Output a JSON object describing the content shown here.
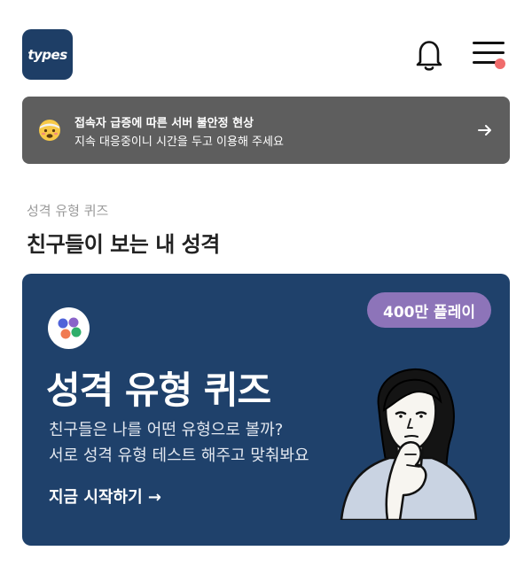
{
  "header": {
    "logo_text": "types",
    "bell_icon": "bell-icon",
    "menu_icon": "hamburger-menu-icon",
    "menu_badge_color": "#f06c6c"
  },
  "notice": {
    "emoji_icon": "overheated-face-emoji-icon",
    "title": "접속자 급증에 따른 서버 불안정 현상",
    "subtitle": "지속 대응중이니 시간을 두고 이용해 주세요",
    "arrow_icon": "arrow-right-icon",
    "background_color": "#5e5e5e"
  },
  "section": {
    "label": "성격 유형 퀴즈",
    "title": "친구들이 보는 내 성격"
  },
  "card": {
    "badge": "400만 플레이",
    "title": "성격 유형 퀴즈",
    "description_lines": [
      "친구들은 나를 어떤 유형으로 볼까?",
      "서로 성격 유형 테스트 해주고 맞춰봐요"
    ],
    "cta": "지금 시작하기 →",
    "icon": "colorful-dots-icon",
    "illustration": "thinking-girl-illustration",
    "background_color": "#1f416b",
    "badge_color": "#8d74b9"
  }
}
